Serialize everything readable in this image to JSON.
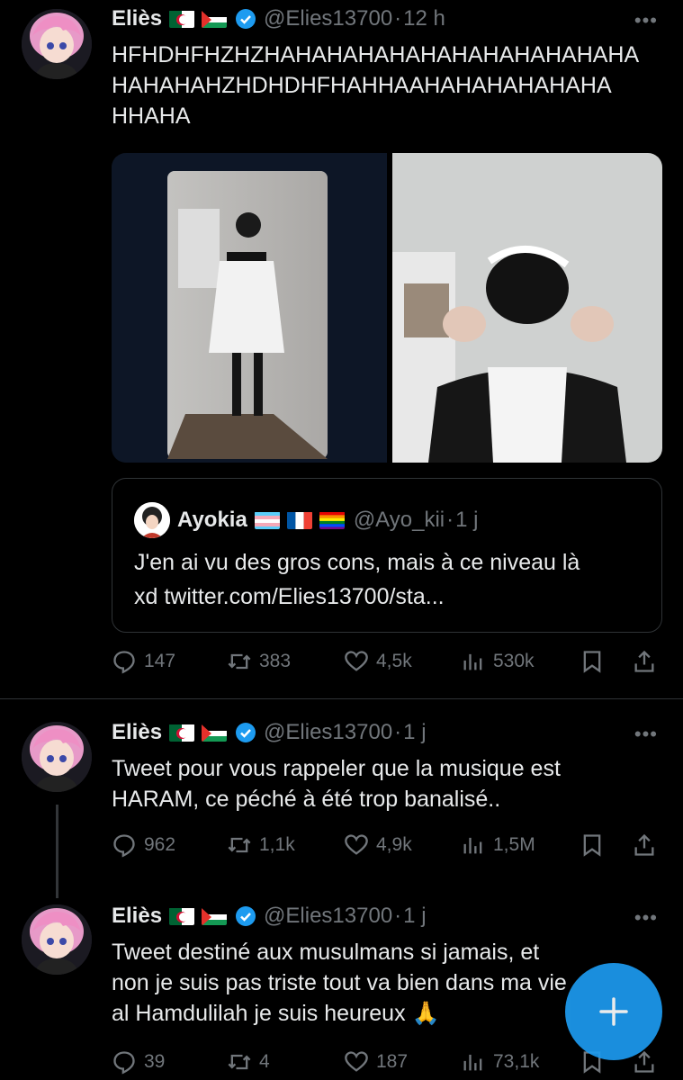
{
  "colors": {
    "accent": "#1d9bf0",
    "background": "#000000",
    "text": "#e7e9ea",
    "muted": "#71767b"
  },
  "tweets": [
    {
      "name": "Eliès",
      "handle": "@Elies13700",
      "time": "12 h",
      "text_lines": [
        "HFHDHFHZHZHAHAHAHAHAHAHAHAHAHAHAHA",
        "HAHAHAHZHDHDHFHAHHAAHAHAHAHAHAHA",
        "HHAHA"
      ],
      "quote": {
        "name": "Ayokia",
        "handle": "@Ayo_kii",
        "time": "1 j",
        "text_lines": [
          "J'en ai vu des gros cons, mais à ce niveau là",
          "xd twitter.com/Elies13700/sta..."
        ]
      },
      "stats": {
        "replies": "147",
        "retweets": "383",
        "likes": "4,5k",
        "views": "530k"
      }
    },
    {
      "name": "Eliès",
      "handle": "@Elies13700",
      "time": "1 j",
      "text_lines": [
        "Tweet pour vous rappeler que la musique est",
        "HARAM, ce péché à été trop banalisé.."
      ],
      "stats": {
        "replies": "962",
        "retweets": "1,1k",
        "likes": "4,9k",
        "views": "1,5M"
      }
    },
    {
      "name": "Eliès",
      "handle": "@Elies13700",
      "time": "1 j",
      "text_lines": [
        "Tweet destiné aux musulmans si jamais, et",
        "non je suis pas triste tout va bien dans ma vie",
        "al Hamdulilah je suis heureux 🙏"
      ],
      "stats": {
        "replies": "39",
        "retweets": "4",
        "likes": "187",
        "views": "73,1k"
      }
    }
  ],
  "icons": [
    "more-icon",
    "verified-icon",
    "reply-icon",
    "retweet-icon",
    "like-icon",
    "views-icon",
    "bookmark-icon",
    "share-icon",
    "compose-plus-icon"
  ]
}
